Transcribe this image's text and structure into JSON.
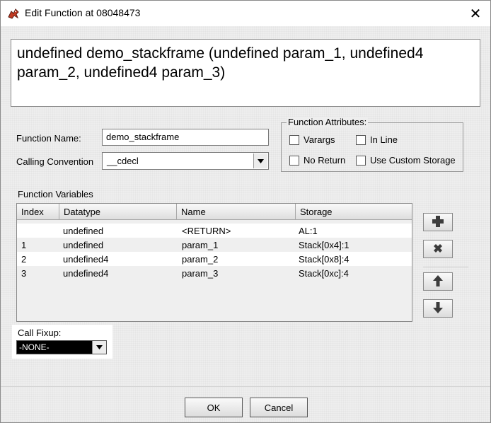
{
  "window": {
    "title": "Edit Function at 08048473"
  },
  "signature": {
    "text": "undefined demo_stackframe (undefined param_1, undefined4 param_2, undefined4 param_3)"
  },
  "form": {
    "name_label": "Function Name:",
    "name_value": "demo_stackframe",
    "cc_label": "Calling Convention",
    "cc_value": "__cdecl"
  },
  "attributes": {
    "legend": "Function Attributes:",
    "varargs": "Varargs",
    "inline": "In Line",
    "no_return": "No Return",
    "custom_storage": "Use Custom Storage",
    "checked": {
      "varargs": false,
      "inline": false,
      "no_return": false,
      "custom_storage": false
    }
  },
  "variables": {
    "label": "Function Variables",
    "columns": [
      "Index",
      "Datatype",
      "Name",
      "Storage"
    ],
    "rows": [
      {
        "index": "",
        "datatype": "undefined",
        "name": "<RETURN>",
        "storage": "AL:1"
      },
      {
        "index": "1",
        "datatype": "undefined",
        "name": "param_1",
        "storage": "Stack[0x4]:1"
      },
      {
        "index": "2",
        "datatype": "undefined4",
        "name": "param_2",
        "storage": "Stack[0x8]:4"
      },
      {
        "index": "3",
        "datatype": "undefined4",
        "name": "param_3",
        "storage": "Stack[0xc]:4"
      }
    ]
  },
  "side_buttons": [
    "add-icon",
    "remove-icon",
    "arrow-up-icon",
    "arrow-down-icon"
  ],
  "fixup": {
    "label": "Call Fixup:",
    "value": "-NONE-"
  },
  "buttons": {
    "ok": "OK",
    "cancel": "Cancel"
  },
  "colors": {
    "icon_dark": "#3c3c3c",
    "dialog_bg": "#eeeeee"
  }
}
